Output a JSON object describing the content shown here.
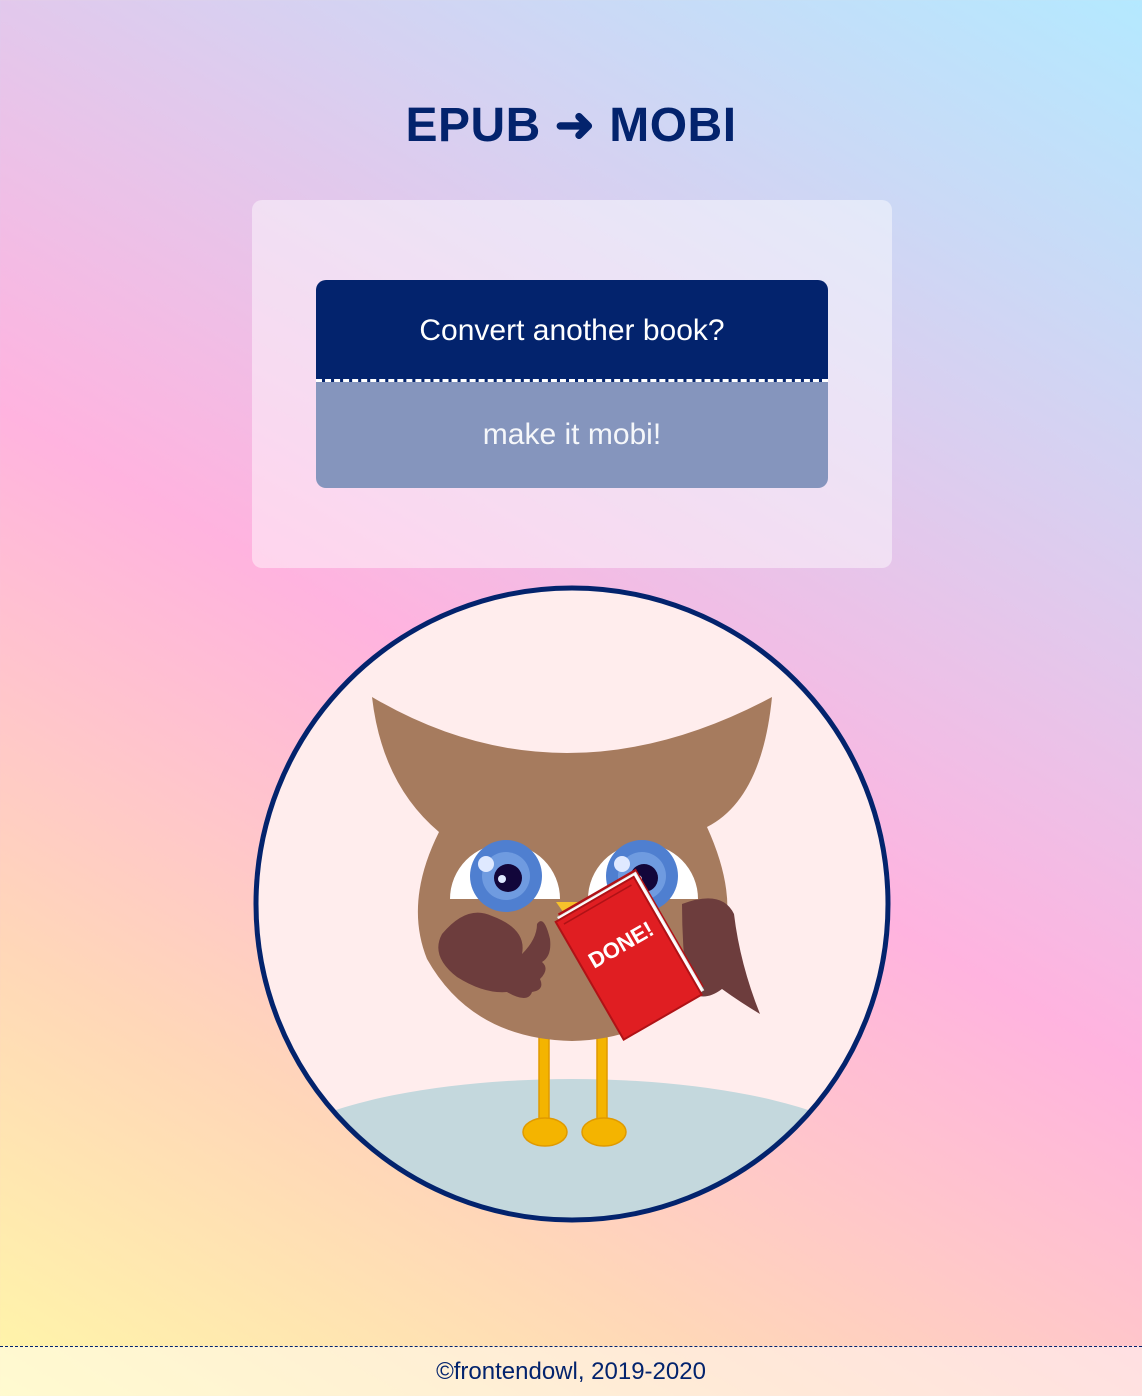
{
  "page": {
    "title": "EPUB ➜ MOBI"
  },
  "converter": {
    "convert_another_label": "Convert another book?",
    "make_mobi_label": "make it mobi!"
  },
  "illustration": {
    "book_text": "DONE!",
    "colors": {
      "frame": "#03236d",
      "background": "#ffeded",
      "ground": "#c4d8dd",
      "body": "#a67b5e",
      "wing": "#6d3d3d",
      "book": "#e01e22",
      "beak": "#f6c12b",
      "feet": "#f4b400",
      "iris": "#4f7fd0"
    }
  },
  "footer": {
    "text": "©frontendowl, 2019-2020"
  }
}
